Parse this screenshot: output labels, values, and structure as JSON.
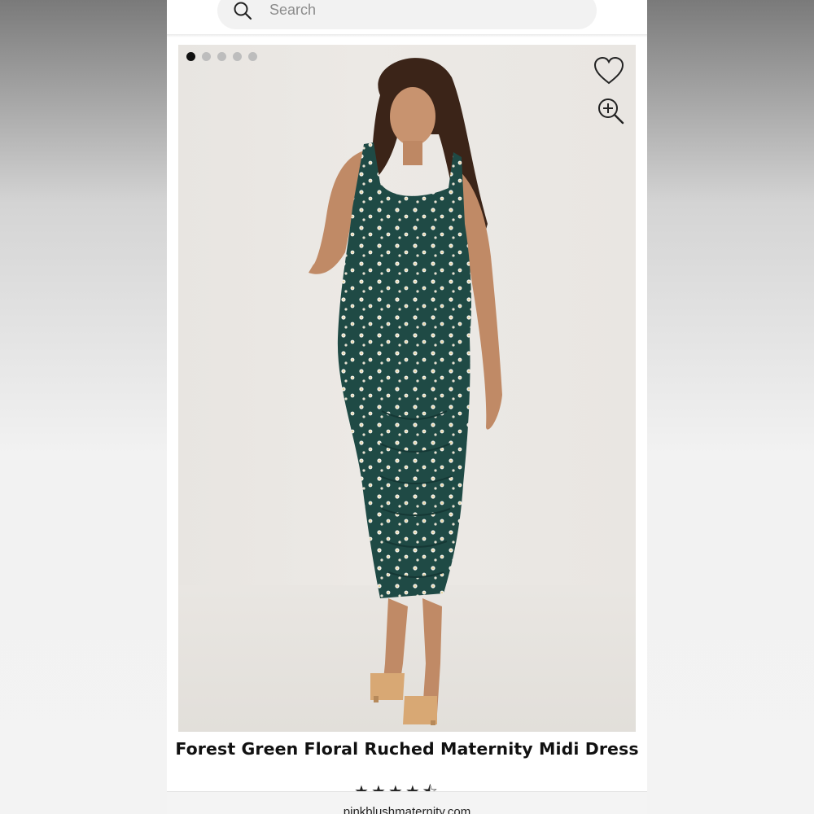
{
  "search": {
    "placeholder": "Search",
    "icon": "search-icon"
  },
  "gallery": {
    "image_count": 5,
    "active_index": 0,
    "favorite_icon": "heart-icon",
    "zoom_icon": "zoom-in-icon"
  },
  "product": {
    "title": "Forest Green Floral Ruched Maternity Midi Dress",
    "rating": 4.5,
    "rating_max": 5
  },
  "browser": {
    "url": "pinkblushmaternity.com"
  },
  "colors": {
    "dress": "#1f4a45",
    "background": "#e9e6e2",
    "active_dot": "#111111",
    "inactive_dot": "#bdbdbd"
  }
}
